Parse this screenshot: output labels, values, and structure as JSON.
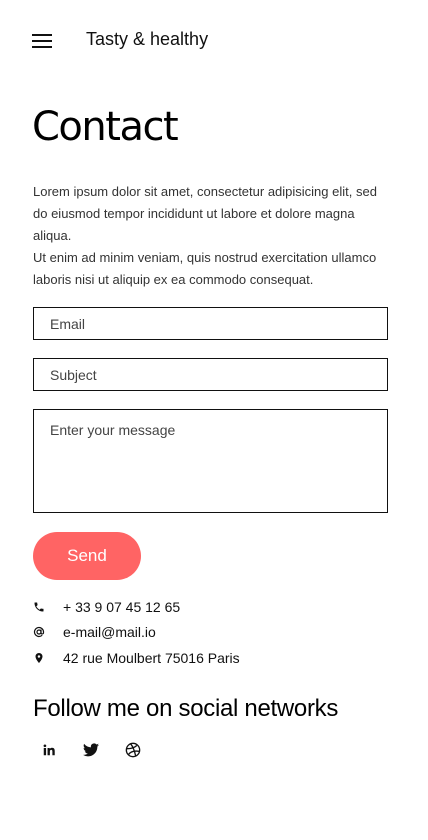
{
  "header": {
    "brand": "Tasty & healthy",
    "menu_icon": "hamburger-menu-icon"
  },
  "page": {
    "title": "Contact",
    "intro_line1": "Lorem ipsum dolor sit amet, consectetur adipisicing elit, sed do eiusmod tempor incididunt ut labore et dolore magna aliqua.",
    "intro_line2": "Ut enim ad minim veniam, quis nostrud exercitation ullamco laboris nisi ut aliquip ex ea commodo consequat."
  },
  "form": {
    "email_placeholder": "Email",
    "subject_placeholder": "Subject",
    "message_placeholder": "Enter your message",
    "send_label": "Send"
  },
  "contact": {
    "phone": "+ 33 9 07 45 12 65",
    "email": "e-mail@mail.io",
    "address": "42 rue Moulbert 75016 Paris"
  },
  "social": {
    "heading": "Follow me on social networks",
    "icons": [
      "linkedin-icon",
      "twitter-icon",
      "dribbble-icon"
    ]
  },
  "colors": {
    "accent": "#ff6464",
    "text": "#111111"
  }
}
